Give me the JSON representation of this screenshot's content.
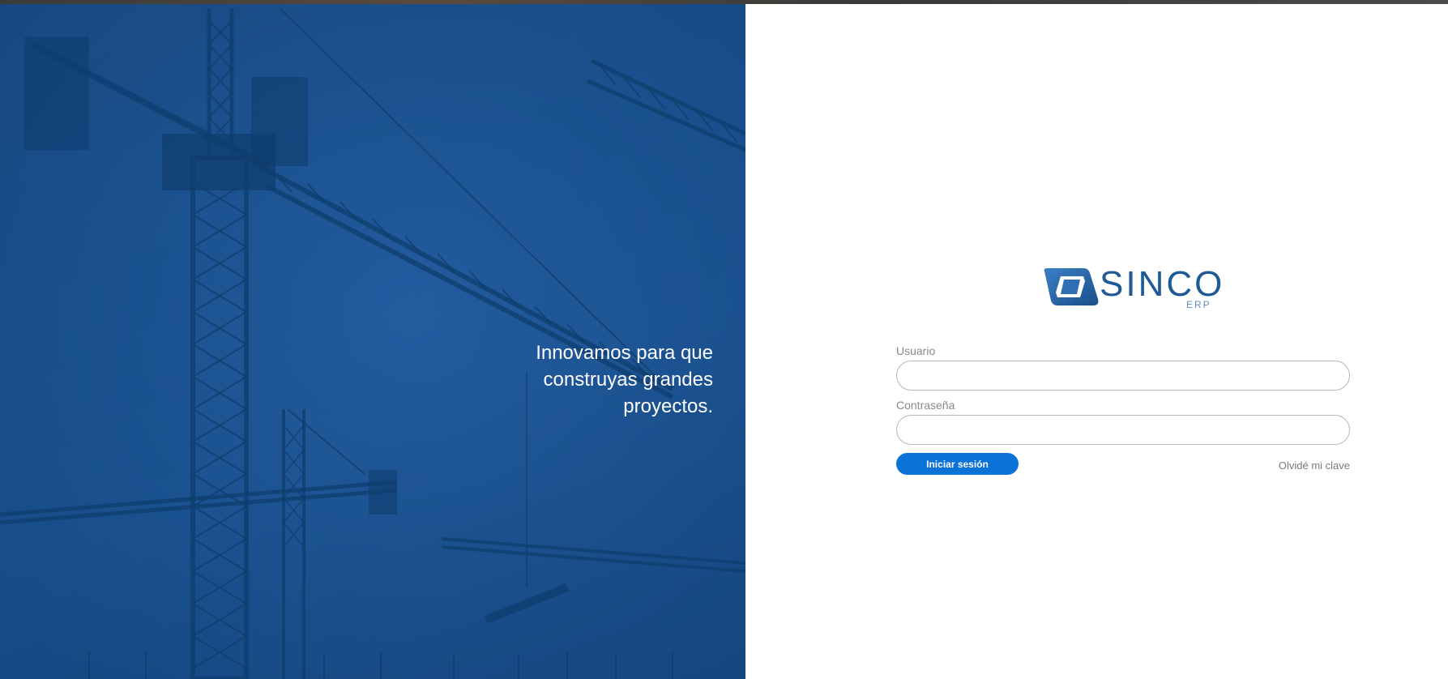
{
  "hero": {
    "tagline": [
      "Innovamos para que",
      "construyas grandes",
      "proyectos."
    ]
  },
  "logo": {
    "name": "SINCO",
    "subtitle": "ERP",
    "icon": "sinco-logo-mark"
  },
  "login_form": {
    "user_label": "Usuario",
    "user_value": "",
    "password_label": "Contraseña",
    "password_value": "",
    "submit_label": "Iniciar sesión",
    "forgot_label": "Olvidé mi clave"
  },
  "colors": {
    "hero_blue": "#175293",
    "button_blue": "#0b72d8",
    "logo_blue": "#1e5a96"
  }
}
